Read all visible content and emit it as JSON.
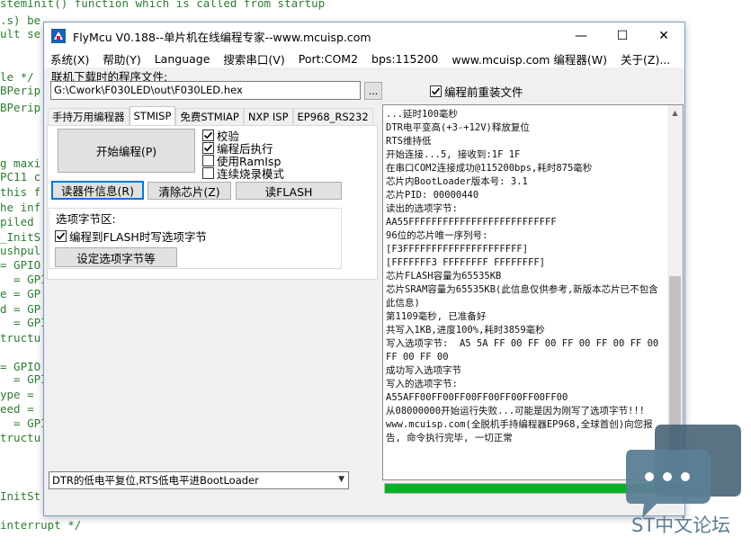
{
  "editor": {
    "lines": [
      "stemInit() function which is called from startup",
      ".s) be",
      "ult se",
      "",
      "le */",
      "BPerip",
      "BPerip",
      "",
      "",
      "g maxi",
      "PC11 c",
      "this f",
      "he inf",
      "piled",
      "_InitS",
      "ushpul",
      "= GPIO",
      "  = GPI",
      "e = GP",
      "d = GP",
      "  = GPI",
      "tructu",
      "",
      "= GPIO",
      "  = GPI",
      "ype = ",
      "eed = ",
      "  = GPI",
      "tructu",
      "",
      "",
      "InitSt",
      "",
      "interrupt */"
    ]
  },
  "window": {
    "title": "FlyMcu V0.188--单片机在线编程专家--www.mcuisp.com",
    "buttons": {
      "minimize": "—",
      "maximize": "☐",
      "close": "✕"
    }
  },
  "menu": [
    "系统(X)",
    "帮助(Y)",
    "Language",
    "搜索串口(V)",
    "Port:COM2",
    "bps:115200",
    "www.mcuisp.com 编程器(W)",
    "关于(Z)..."
  ],
  "file": {
    "label": "联机下载时的程序文件:",
    "path": "G:\\Cwork\\F030LED\\out\\F030LED.hex",
    "browse": "...",
    "reload_label": "编程前重装文件",
    "reload_checked": true
  },
  "tabs": [
    "手持万用编程器",
    "STMISP",
    "免费STMIAP",
    "NXP ISP",
    "EP968_RS232"
  ],
  "active_tab": 1,
  "stmisp": {
    "start_btn": "开始编程(P)",
    "options": [
      {
        "label": "校验",
        "checked": true
      },
      {
        "label": "编程后执行",
        "checked": true
      },
      {
        "label": "使用RamIsp",
        "checked": false
      },
      {
        "label": "连续烧录模式",
        "checked": false
      }
    ],
    "read_info_btn": "读器件信息(R)",
    "erase_btn": "清除芯片(Z)",
    "read_flash_btn": "读FLASH",
    "option_group_title": "选项字节区:",
    "write_option_label": "编程到FLASH时写选项字节",
    "write_option_checked": true,
    "set_option_btn": "设定选项字节等"
  },
  "log": {
    "lines": [
      "...延时100毫秒",
      "DTR电平变高(+3-+12V)释放复位",
      "RTS维持低",
      "开始连接...5, 接收到:1F 1F",
      "在串口COM2连接成功@115200bps,耗时875毫秒",
      "芯片内BootLoader版本号: 3.1",
      "芯片PID: 00000440",
      "读出的选项字节:",
      "AA55FFFFFFFFFFFFFFFFFFFFFFFFFF",
      "96位的芯片唯一序列号:",
      "[F3FFFFFFFFFFFFFFFFFFFFF]",
      "[FFFFFFF3 FFFFFFFF FFFFFFFF]",
      "芯片FLASH容量为65535KB",
      "芯片SRAM容量为65535KB(此信息仅供参考,新版本芯片已不包含此信息)",
      "第1109毫秒, 已准备好",
      "共写入1KB,进度100%,耗时3859毫秒",
      "写入选项字节:  A5 5A FF 00 FF 00 FF 00 FF 00 FF 00 FF 00 FF 00",
      "成功写入选项字节",
      "写入的选项字节:",
      "A55AFF00FF00FF00FF00FF00FF00FF00",
      "从08000000开始运行失败...可能是因为刚写了选项字节!!!",
      "www.mcuisp.com(全脱机手持编程器EP968,全球首创)向您报告, 命令执行完毕, 一切正常"
    ]
  },
  "progress": {
    "value": 1.0,
    "color": "#06b025"
  },
  "reset_mode": {
    "selected": "DTR的低电平复位,RTS低电平进BootLoader"
  },
  "watermark": {
    "text": "ST中文论坛",
    "color": "#5a7c92"
  }
}
